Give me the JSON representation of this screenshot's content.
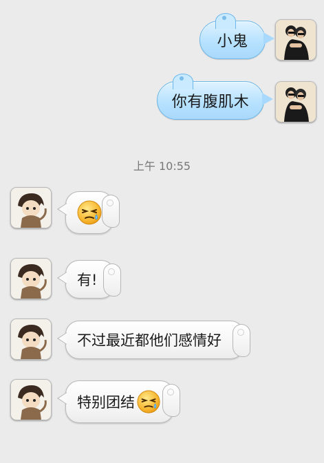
{
  "header": {},
  "messages": {
    "out": [
      {
        "text": "小鬼"
      },
      {
        "text": "你有腹肌木"
      }
    ],
    "timestamp": "上午 10:55",
    "in": [
      {
        "text": "",
        "emoji": "sweat-squint-emoji"
      },
      {
        "text": "有!"
      },
      {
        "text": "不过最近都他们感情好"
      },
      {
        "text": "特别团结",
        "emoji": "sweat-squint-emoji"
      }
    ]
  },
  "colors": {
    "background": "#ebebeb",
    "outgoing_bubble": "#b7e2ff",
    "incoming_bubble": "#f4f4f4",
    "timestamp_text": "#777777"
  },
  "icons": {
    "self_avatar": "couple-photo-avatar",
    "peer_avatar": "monkey-costume-boy-avatar"
  }
}
